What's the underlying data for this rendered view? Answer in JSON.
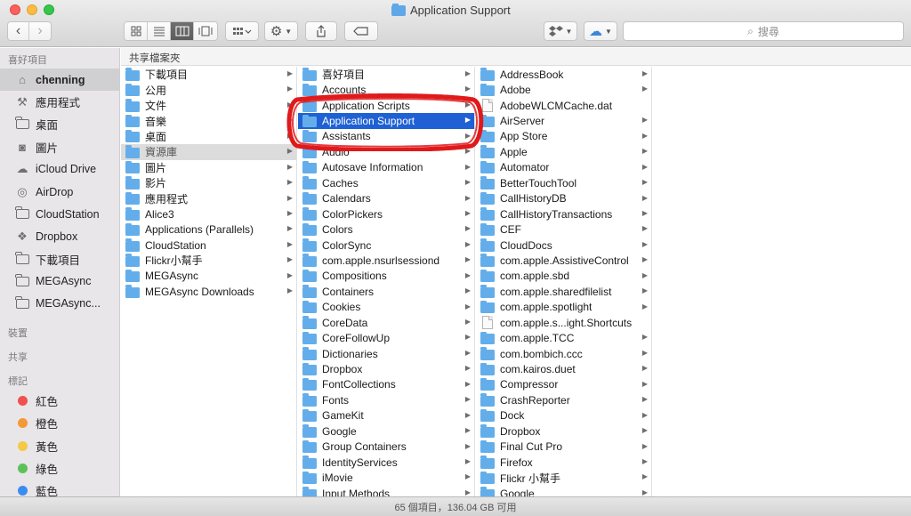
{
  "window": {
    "title": "Application Support"
  },
  "toolbar": {
    "back_label": "‹",
    "forward_label": "›",
    "search_placeholder": "搜尋"
  },
  "sidebar": {
    "favorites_header": "喜好項目",
    "favorites": [
      {
        "label": "chenning",
        "icon": "home-icon",
        "selected": true
      },
      {
        "label": "應用程式",
        "icon": "applications-icon"
      },
      {
        "label": "桌面",
        "icon": "desktop-folder-icon"
      },
      {
        "label": "圖片",
        "icon": "camera-icon"
      },
      {
        "label": "iCloud Drive",
        "icon": "cloud-icon"
      },
      {
        "label": "AirDrop",
        "icon": "airdrop-icon"
      },
      {
        "label": "CloudStation",
        "icon": "folder-icon"
      },
      {
        "label": "Dropbox",
        "icon": "dropbox-icon"
      },
      {
        "label": "下載項目",
        "icon": "folder-icon"
      },
      {
        "label": "MEGAsync",
        "icon": "folder-icon"
      },
      {
        "label": "MEGAsync...",
        "icon": "folder-icon"
      }
    ],
    "devices_header": "裝置",
    "shared_header": "共享",
    "tags_header": "標記",
    "tags": [
      {
        "label": "紅色",
        "color": "#f0504e"
      },
      {
        "label": "橙色",
        "color": "#f39a38"
      },
      {
        "label": "黃色",
        "color": "#f3c947"
      },
      {
        "label": "綠色",
        "color": "#5cc258"
      },
      {
        "label": "藍色",
        "color": "#3b8cf0"
      }
    ]
  },
  "pathbar": {
    "label": "共享檔案夾"
  },
  "columns": [
    [
      {
        "name": "下載項目",
        "arrow": true,
        "type": "folder"
      },
      {
        "name": "公用",
        "arrow": true,
        "type": "folder"
      },
      {
        "name": "文件",
        "arrow": true,
        "type": "folder"
      },
      {
        "name": "音樂",
        "arrow": true,
        "type": "folder"
      },
      {
        "name": "桌面",
        "arrow": true,
        "type": "folder"
      },
      {
        "name": "資源庫",
        "arrow": true,
        "type": "folder",
        "state": "highlight"
      },
      {
        "name": "圖片",
        "arrow": true,
        "type": "folder"
      },
      {
        "name": "影片",
        "arrow": true,
        "type": "folder"
      },
      {
        "name": "應用程式",
        "arrow": true,
        "type": "folder"
      },
      {
        "name": "Alice3",
        "arrow": true,
        "type": "folder"
      },
      {
        "name": "Applications (Parallels)",
        "arrow": true,
        "type": "folder"
      },
      {
        "name": "CloudStation",
        "arrow": true,
        "type": "folder"
      },
      {
        "name": "Flickr小幫手",
        "arrow": true,
        "type": "folder"
      },
      {
        "name": "MEGAsync",
        "arrow": true,
        "type": "folder"
      },
      {
        "name": "MEGAsync Downloads",
        "arrow": true,
        "type": "folder"
      }
    ],
    [
      {
        "name": "喜好項目",
        "arrow": true,
        "type": "folder"
      },
      {
        "name": "Accounts",
        "arrow": true,
        "type": "folder"
      },
      {
        "name": "Application Scripts",
        "arrow": true,
        "type": "folder"
      },
      {
        "name": "Application Support",
        "arrow": true,
        "type": "folder",
        "state": "selected"
      },
      {
        "name": "Assistants",
        "arrow": true,
        "type": "folder"
      },
      {
        "name": "Audio",
        "arrow": true,
        "type": "folder"
      },
      {
        "name": "Autosave Information",
        "arrow": true,
        "type": "folder"
      },
      {
        "name": "Caches",
        "arrow": true,
        "type": "folder"
      },
      {
        "name": "Calendars",
        "arrow": true,
        "type": "folder"
      },
      {
        "name": "ColorPickers",
        "arrow": true,
        "type": "folder"
      },
      {
        "name": "Colors",
        "arrow": true,
        "type": "folder"
      },
      {
        "name": "ColorSync",
        "arrow": true,
        "type": "folder"
      },
      {
        "name": "com.apple.nsurlsessiond",
        "arrow": true,
        "type": "folder"
      },
      {
        "name": "Compositions",
        "arrow": true,
        "type": "folder"
      },
      {
        "name": "Containers",
        "arrow": true,
        "type": "folder"
      },
      {
        "name": "Cookies",
        "arrow": true,
        "type": "folder"
      },
      {
        "name": "CoreData",
        "arrow": true,
        "type": "folder"
      },
      {
        "name": "CoreFollowUp",
        "arrow": true,
        "type": "folder"
      },
      {
        "name": "Dictionaries",
        "arrow": true,
        "type": "folder"
      },
      {
        "name": "Dropbox",
        "arrow": true,
        "type": "folder"
      },
      {
        "name": "FontCollections",
        "arrow": true,
        "type": "folder"
      },
      {
        "name": "Fonts",
        "arrow": true,
        "type": "folder"
      },
      {
        "name": "GameKit",
        "arrow": true,
        "type": "folder"
      },
      {
        "name": "Google",
        "arrow": true,
        "type": "folder"
      },
      {
        "name": "Group Containers",
        "arrow": true,
        "type": "folder"
      },
      {
        "name": "IdentityServices",
        "arrow": true,
        "type": "folder"
      },
      {
        "name": "iMovie",
        "arrow": true,
        "type": "folder"
      },
      {
        "name": "Input Methods",
        "arrow": true,
        "type": "folder"
      }
    ],
    [
      {
        "name": "AddressBook",
        "arrow": true,
        "type": "folder"
      },
      {
        "name": "Adobe",
        "arrow": true,
        "type": "folder"
      },
      {
        "name": "AdobeWLCMCache.dat",
        "arrow": false,
        "type": "file"
      },
      {
        "name": "AirServer",
        "arrow": true,
        "type": "folder"
      },
      {
        "name": "App Store",
        "arrow": true,
        "type": "folder"
      },
      {
        "name": "Apple",
        "arrow": true,
        "type": "folder"
      },
      {
        "name": "Automator",
        "arrow": true,
        "type": "folder"
      },
      {
        "name": "BetterTouchTool",
        "arrow": true,
        "type": "folder"
      },
      {
        "name": "CallHistoryDB",
        "arrow": true,
        "type": "folder"
      },
      {
        "name": "CallHistoryTransactions",
        "arrow": true,
        "type": "folder"
      },
      {
        "name": "CEF",
        "arrow": true,
        "type": "folder"
      },
      {
        "name": "CloudDocs",
        "arrow": true,
        "type": "folder"
      },
      {
        "name": "com.apple.AssistiveControl",
        "arrow": true,
        "type": "folder"
      },
      {
        "name": "com.apple.sbd",
        "arrow": true,
        "type": "folder"
      },
      {
        "name": "com.apple.sharedfilelist",
        "arrow": true,
        "type": "folder"
      },
      {
        "name": "com.apple.spotlight",
        "arrow": true,
        "type": "folder"
      },
      {
        "name": "com.apple.s...ight.Shortcuts",
        "arrow": false,
        "type": "file"
      },
      {
        "name": "com.apple.TCC",
        "arrow": true,
        "type": "folder"
      },
      {
        "name": "com.bombich.ccc",
        "arrow": true,
        "type": "folder"
      },
      {
        "name": "com.kairos.duet",
        "arrow": true,
        "type": "folder"
      },
      {
        "name": "Compressor",
        "arrow": true,
        "type": "folder"
      },
      {
        "name": "CrashReporter",
        "arrow": true,
        "type": "folder"
      },
      {
        "name": "Dock",
        "arrow": true,
        "type": "folder"
      },
      {
        "name": "Dropbox",
        "arrow": true,
        "type": "folder"
      },
      {
        "name": "Final Cut Pro",
        "arrow": true,
        "type": "folder"
      },
      {
        "name": "Firefox",
        "arrow": true,
        "type": "folder"
      },
      {
        "name": "Flickr 小幫手",
        "arrow": true,
        "type": "folder"
      },
      {
        "name": "Google",
        "arrow": true,
        "type": "folder"
      }
    ]
  ],
  "status": {
    "text": "65 個項目，136.04 GB 可用"
  },
  "colors": {
    "selection": "#1f61d4",
    "folder": "#63aeea",
    "annotation": "#e0191b"
  }
}
